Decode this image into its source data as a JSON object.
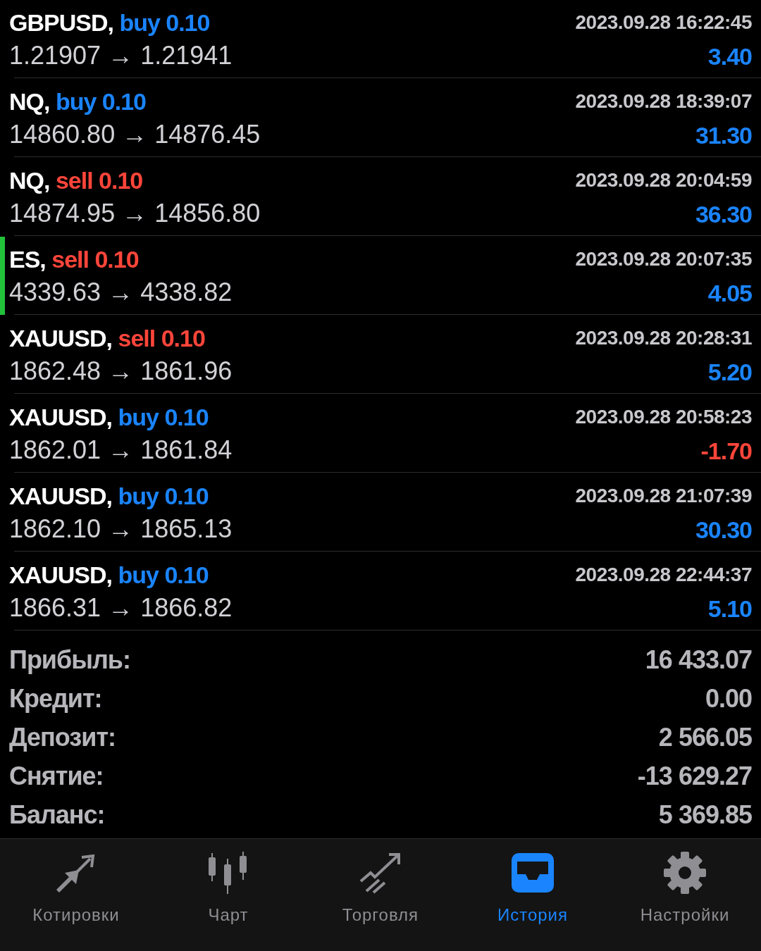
{
  "deals": [
    {
      "symbol": "GBPUSD,",
      "kind": "buy",
      "order": "buy 0.10",
      "prices": "1.21907 → 1.21941",
      "time": "2023.09.28 16:22:45",
      "profit": "3.40",
      "loss": false,
      "selected": false
    },
    {
      "symbol": "NQ,",
      "kind": "buy",
      "order": "buy 0.10",
      "prices": "14860.80 → 14876.45",
      "time": "2023.09.28 18:39:07",
      "profit": "31.30",
      "loss": false,
      "selected": false
    },
    {
      "symbol": "NQ,",
      "kind": "sell",
      "order": "sell 0.10",
      "prices": "14874.95 → 14856.80",
      "time": "2023.09.28 20:04:59",
      "profit": "36.30",
      "loss": false,
      "selected": false
    },
    {
      "symbol": "ES,",
      "kind": "sell",
      "order": "sell 0.10",
      "prices": "4339.63 → 4338.82",
      "time": "2023.09.28 20:07:35",
      "profit": "4.05",
      "loss": false,
      "selected": true
    },
    {
      "symbol": "XAUUSD,",
      "kind": "sell",
      "order": "sell 0.10",
      "prices": "1862.48 → 1861.96",
      "time": "2023.09.28 20:28:31",
      "profit": "5.20",
      "loss": false,
      "selected": false
    },
    {
      "symbol": "XAUUSD,",
      "kind": "buy",
      "order": "buy 0.10",
      "prices": "1862.01 → 1861.84",
      "time": "2023.09.28 20:58:23",
      "profit": "-1.70",
      "loss": true,
      "selected": false
    },
    {
      "symbol": "XAUUSD,",
      "kind": "buy",
      "order": "buy 0.10",
      "prices": "1862.10 → 1865.13",
      "time": "2023.09.28 21:07:39",
      "profit": "30.30",
      "loss": false,
      "selected": false
    },
    {
      "symbol": "XAUUSD,",
      "kind": "buy",
      "order": "buy 0.10",
      "prices": "1866.31 → 1866.82",
      "time": "2023.09.28 22:44:37",
      "profit": "5.10",
      "loss": false,
      "selected": false
    }
  ],
  "summary": [
    {
      "label": "Прибыль:",
      "value": "16 433.07"
    },
    {
      "label": "Кредит:",
      "value": "0.00"
    },
    {
      "label": "Депозит:",
      "value": "2 566.05"
    },
    {
      "label": "Снятие:",
      "value": "-13 629.27"
    },
    {
      "label": "Баланс:",
      "value": "5 369.85"
    }
  ],
  "tabs": [
    {
      "label": "Котировки",
      "selected": false
    },
    {
      "label": "Чарт",
      "selected": false
    },
    {
      "label": "Торговля",
      "selected": false
    },
    {
      "label": "История",
      "selected": true
    },
    {
      "label": "Настройки",
      "selected": false
    }
  ]
}
